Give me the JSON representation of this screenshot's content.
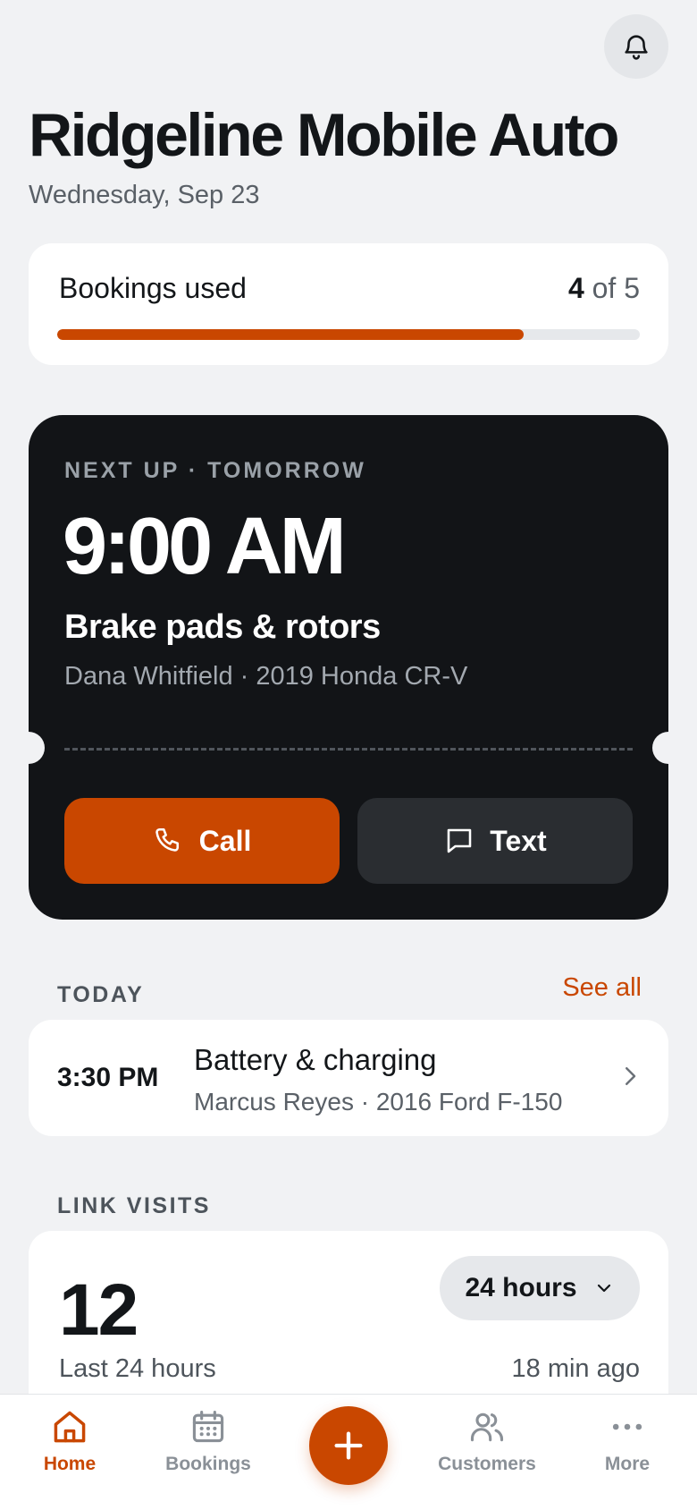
{
  "header": {
    "title": "Ridgeline Mobile Auto",
    "date": "Wednesday, Sep 23",
    "bell_icon": "bell-icon"
  },
  "usage": {
    "label": "Bookings used",
    "used": "4",
    "of_text": " of 5",
    "fraction": 0.8,
    "accent": "#c94700"
  },
  "next_up": {
    "eyebrow": "NEXT UP · TOMORROW",
    "time": "9:00 AM",
    "service": "Brake pads & rotors",
    "customer": "Dana Whitfield · 2019 Honda CR-V",
    "call_label": "Call",
    "call_icon": "phone-icon",
    "text_label": "Text",
    "text_icon": "chat-bubble-icon"
  },
  "today": {
    "section_label": "TODAY",
    "see_all": "See all",
    "item": {
      "time": "3:30 PM",
      "service": "Battery & charging",
      "customer": "Marcus Reyes · 2016 Ford F-150"
    }
  },
  "link_visits": {
    "section_label": "LINK VISITS",
    "count": "12",
    "range": "24 hours",
    "subtitle": "Last 24 hours",
    "updated": "18 min ago"
  },
  "tabbar": {
    "home": "Home",
    "bookings": "Bookings",
    "customers": "Customers",
    "more": "More",
    "fab_icon": "plus-icon"
  }
}
